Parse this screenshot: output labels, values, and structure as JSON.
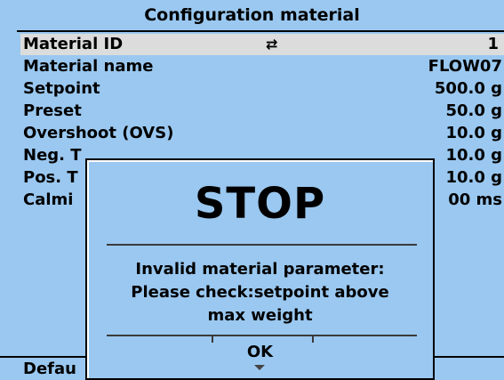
{
  "window": {
    "title": "Configuration material"
  },
  "rows": [
    {
      "label": "Material ID",
      "value": "1",
      "arrows": "⇄"
    },
    {
      "label": "Material name",
      "value": "FLOW07"
    },
    {
      "label": "Setpoint",
      "value": "500.0 g"
    },
    {
      "label": "Preset",
      "value": "50.0 g"
    },
    {
      "label": "Overshoot (OVS)",
      "value": "10.0 g"
    },
    {
      "label": "Neg. T",
      "value": "10.0 g"
    },
    {
      "label": "Pos. T",
      "value": "10.0 g"
    },
    {
      "label": "Calmi",
      "value": "00 ms"
    }
  ],
  "footer": {
    "label": "Defau"
  },
  "dialog": {
    "heading": "STOP",
    "message_line1": "Invalid material parameter:",
    "message_line2": "Please check:setpoint above",
    "message_line3": "max weight",
    "ok_label": "OK"
  },
  "colors": {
    "background": "#9ac8f0",
    "selected_row": "#dcdcdc"
  }
}
